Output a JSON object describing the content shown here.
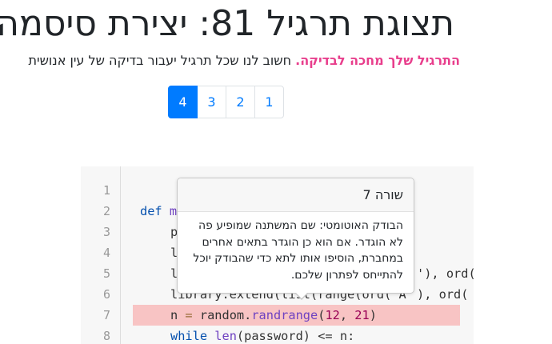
{
  "header": {
    "title": "תצוגת תרגיל 81: יצירת סיסמה",
    "subtitle_strong": "התרגיל שלך מחכה לבדיקה.",
    "subtitle_rest": " חשוב לנו שכל תרגיל יעבור בדיקה של עין אנושית"
  },
  "pagination": {
    "pages": [
      "1",
      "2",
      "3",
      "4"
    ],
    "active": "4"
  },
  "editor": {
    "line_numbers": [
      "1",
      "2",
      "3",
      "4",
      "5",
      "6",
      "7",
      "8"
    ],
    "highlighted_line": "7",
    "lines": {
      "l2_kw": "def",
      "l2_name": "m",
      "l3": "p",
      "l4": "l",
      "l5_head": "l",
      "l5_tail": "'), ord(",
      "l6_head": "library.extend(list(range(ord('A'",
      "l6_tail": "), ord(",
      "l7_var": "n",
      "l7_eq": " = ",
      "l7_mod": "random",
      "l7_dot": ".",
      "l7_fn": "randrange",
      "l7_open": "(",
      "l7_a": "12",
      "l7_comma": ", ",
      "l7_b": "21",
      "l7_close": ")",
      "l8_kw": "while",
      "l8_fn": "len",
      "l8_rest": "(password) <= n:"
    }
  },
  "popover": {
    "title": "שורה 7",
    "body": "הבודק האוטומטי: שם המשתנה שמופיע פה לא הוגדר. אם הוא כן הוגדר בתאים אחרים במחברת, הוסיפו אותו לתא כדי שהבודק יוכל להתייחס לפתרון שלכם."
  },
  "colors": {
    "accent": "#007bff",
    "warning_text": "#e83e8c",
    "highlight_row": "#f8c4c4"
  }
}
